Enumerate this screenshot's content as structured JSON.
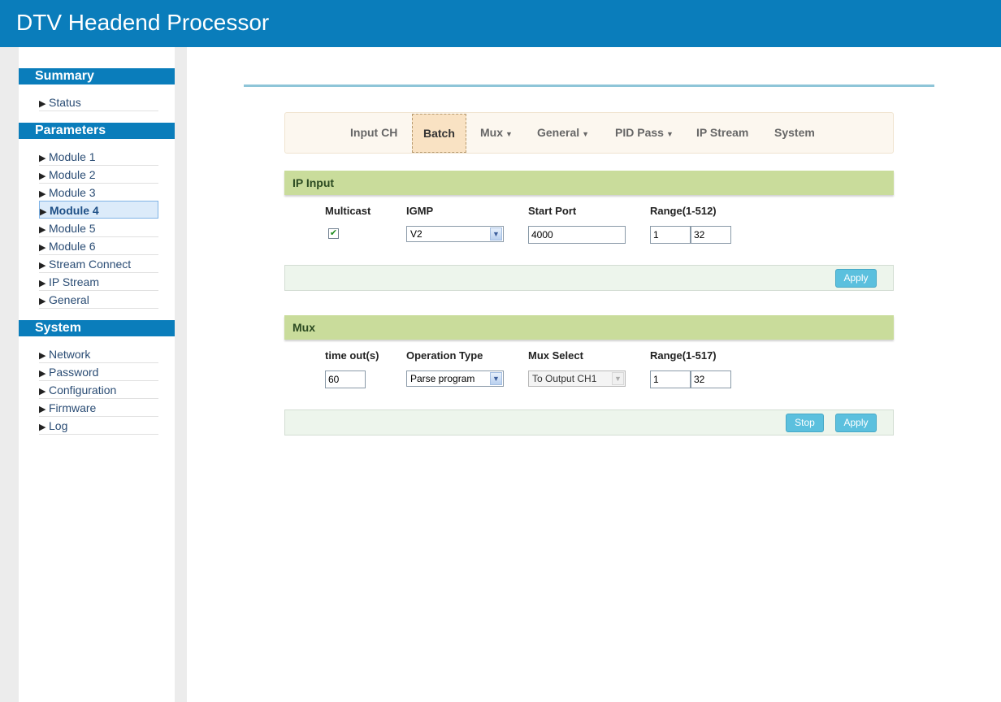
{
  "app": {
    "title": "DTV Headend Processor"
  },
  "sidebar": {
    "summary": {
      "heading": "Summary",
      "items": [
        {
          "label": "Status"
        }
      ]
    },
    "parameters": {
      "heading": "Parameters",
      "items": [
        {
          "label": "Module 1"
        },
        {
          "label": "Module 2"
        },
        {
          "label": "Module 3"
        },
        {
          "label": "Module 4",
          "active": true
        },
        {
          "label": "Module 5"
        },
        {
          "label": "Module 6"
        },
        {
          "label": "Stream Connect"
        },
        {
          "label": "IP Stream"
        },
        {
          "label": "General"
        }
      ]
    },
    "system": {
      "heading": "System",
      "items": [
        {
          "label": "Network"
        },
        {
          "label": "Password"
        },
        {
          "label": "Configuration"
        },
        {
          "label": "Firmware"
        },
        {
          "label": "Log"
        }
      ]
    }
  },
  "tabs": [
    {
      "label": "Input CH"
    },
    {
      "label": "Batch",
      "active": true
    },
    {
      "label": "Mux"
    },
    {
      "label": "General"
    },
    {
      "label": "PID Pass"
    },
    {
      "label": "IP Stream"
    },
    {
      "label": "System"
    }
  ],
  "ip_input": {
    "heading": "IP Input",
    "multicast_label": "Multicast",
    "multicast_checked": true,
    "igmp_label": "IGMP",
    "igmp_value": "V2",
    "start_port_label": "Start Port",
    "start_port_value": "4000",
    "range_label": "Range(1-512)",
    "range_from": "1",
    "range_to": "32",
    "apply_label": "Apply"
  },
  "mux": {
    "heading": "Mux",
    "timeout_label": "time out(s)",
    "timeout_value": "60",
    "operation_type_label": "Operation Type",
    "operation_type_value": "Parse program",
    "mux_select_label": "Mux Select",
    "mux_select_value": "To Output CH1",
    "range_label": "Range(1-517)",
    "range_from": "1",
    "range_to": "32",
    "stop_label": "Stop",
    "apply_label": "Apply"
  },
  "colors": {
    "header": "#0a7dbb",
    "panel_head": "#c9dc9b",
    "button": "#5bc0de"
  }
}
